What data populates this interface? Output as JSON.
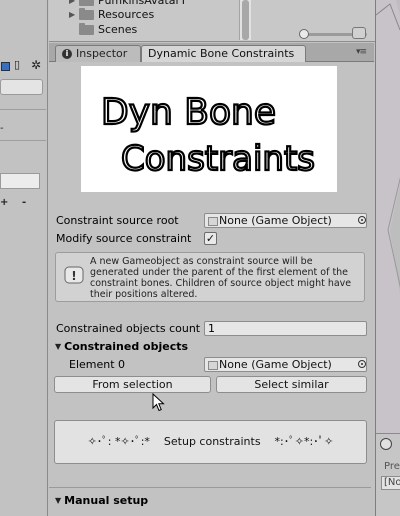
{
  "project": {
    "tree_items": [
      {
        "label": "PumkinsAvatarT"
      },
      {
        "label": "Resources"
      },
      {
        "label": "Scenes"
      }
    ]
  },
  "inspector": {
    "tab_inspector": "Inspector",
    "tab_component": "Dynamic Bone Constraints",
    "tab_menu": "▾≡",
    "banner_line1": "Dyn Bone",
    "banner_line2": "Constraints",
    "constraint_source_root_label": "Constraint source root",
    "constraint_source_root_value": "None (Game Object)",
    "modify_source_label": "Modify source constraint",
    "modify_source_checked": "✓",
    "help_text": "A new Gameobject as constraint source will be generated under the parent of the first element of the constraint bones. Children of source object might have their positions altered.",
    "constrained_count_label": "Constrained objects count",
    "constrained_count_value": "1",
    "constrained_objects_header": "Constrained objects",
    "element0_label": "Element 0",
    "element0_value": "None (Game Object)",
    "from_selection_button": "From selection",
    "select_similar_button": "Select similar",
    "setup_button": "✧･ﾟ: *✧･ﾟ:*    Setup constraints    *:･ﾟ✧*:･ﾟ✧",
    "manual_setup_header": "Manual setup"
  },
  "scene": {
    "label": "Pre",
    "field": "[No"
  },
  "colors": {
    "panel_bg": "#c2c2c2",
    "tab_active": "#d6d6d6",
    "button_bg": "#e4e4e4",
    "field_bg": "#e6e6e6"
  }
}
